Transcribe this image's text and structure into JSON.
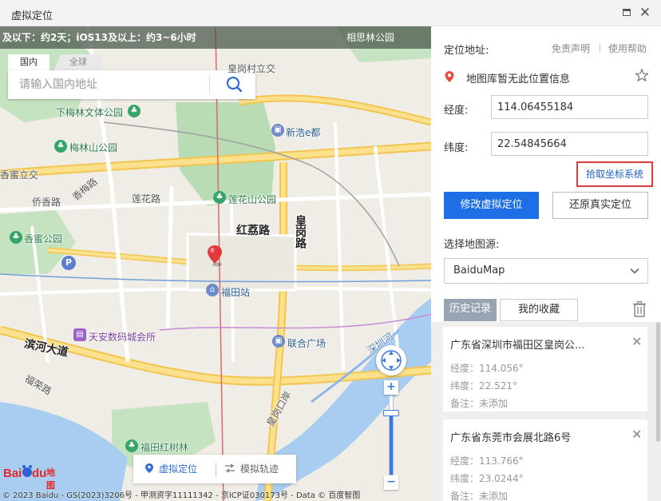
{
  "window": {
    "title": "虚拟定位"
  },
  "map": {
    "notice": "及以下：约2天；iOS13及以上：约3~6小时",
    "notice_poi": "相思林公园",
    "search": {
      "tabs": [
        "国内",
        "全球"
      ],
      "placeholder": "请输入国内地址"
    },
    "labels": {
      "huanggang_bridge": "皇岗村立交",
      "xiameilin_park": "下梅林文体公园",
      "xinhao": "新浩e都",
      "meilinshan_park": "梅林山公园",
      "xiangmi_jiao": "香蜜立交",
      "xiangmei_road": "香梅路",
      "qiaoxiang_road": "侨香路",
      "lianhua_road": "莲花路",
      "lianhuashan_park": "莲花山公园",
      "honglinroad": "红荔路",
      "huanggang_road": "皇岗路",
      "xiangmi_park": "香蜜公园",
      "futian_station": "福田站",
      "tianan_mall": "天安数码城会所",
      "binhe": "滨河大道",
      "lianhe_plaza": "联合广场",
      "fuqiang_road": "福荣路",
      "futian_mangrove": "福田红树林",
      "huanggang_port": "皇岗口岸",
      "shenzhen_river": "深圳河"
    },
    "modes": {
      "virtual": "虚拟定位",
      "route": "模拟轨迹"
    },
    "logo_text": "地图",
    "copyright": "© 2023 Baidu - GS(2023)3206号 - 甲测资字11111342 - 京ICP证030173号 - Data © 百度智图",
    "zoom_level": 0.78
  },
  "panel": {
    "address_label": "定位地址:",
    "disclaimer": "免责声明",
    "help": "使用帮助",
    "location_text": "地图库暂无此位置信息",
    "lng_label": "经度:",
    "lng_value": "114.06455184",
    "lat_label": "纬度:",
    "lat_value": "22.54845664",
    "pick_coords": "拾取坐标系统",
    "modify_btn": "修改虚拟定位",
    "restore_btn": "还原真实定位",
    "map_source_label": "选择地图源:",
    "map_source_value": "BaiduMap",
    "history_tab": "历史记录",
    "favorites_tab": "我的收藏",
    "history": [
      {
        "title": "广东省深圳市福田区皇岗公...",
        "lng": "经度：114.056°",
        "lat": "纬度：22.521°",
        "note": "备注：未添加"
      },
      {
        "title": "广东省东莞市会展北路6号",
        "lng": "经度：113.766°",
        "lat": "纬度：23.0244°",
        "note": "备注：未添加"
      }
    ]
  },
  "colors": {
    "primary": "#1e6fe6",
    "pick_border": "#e03c3c",
    "road_major": "#f7d36b",
    "park": "#b9dcb5",
    "water": "#a9cdf0"
  }
}
